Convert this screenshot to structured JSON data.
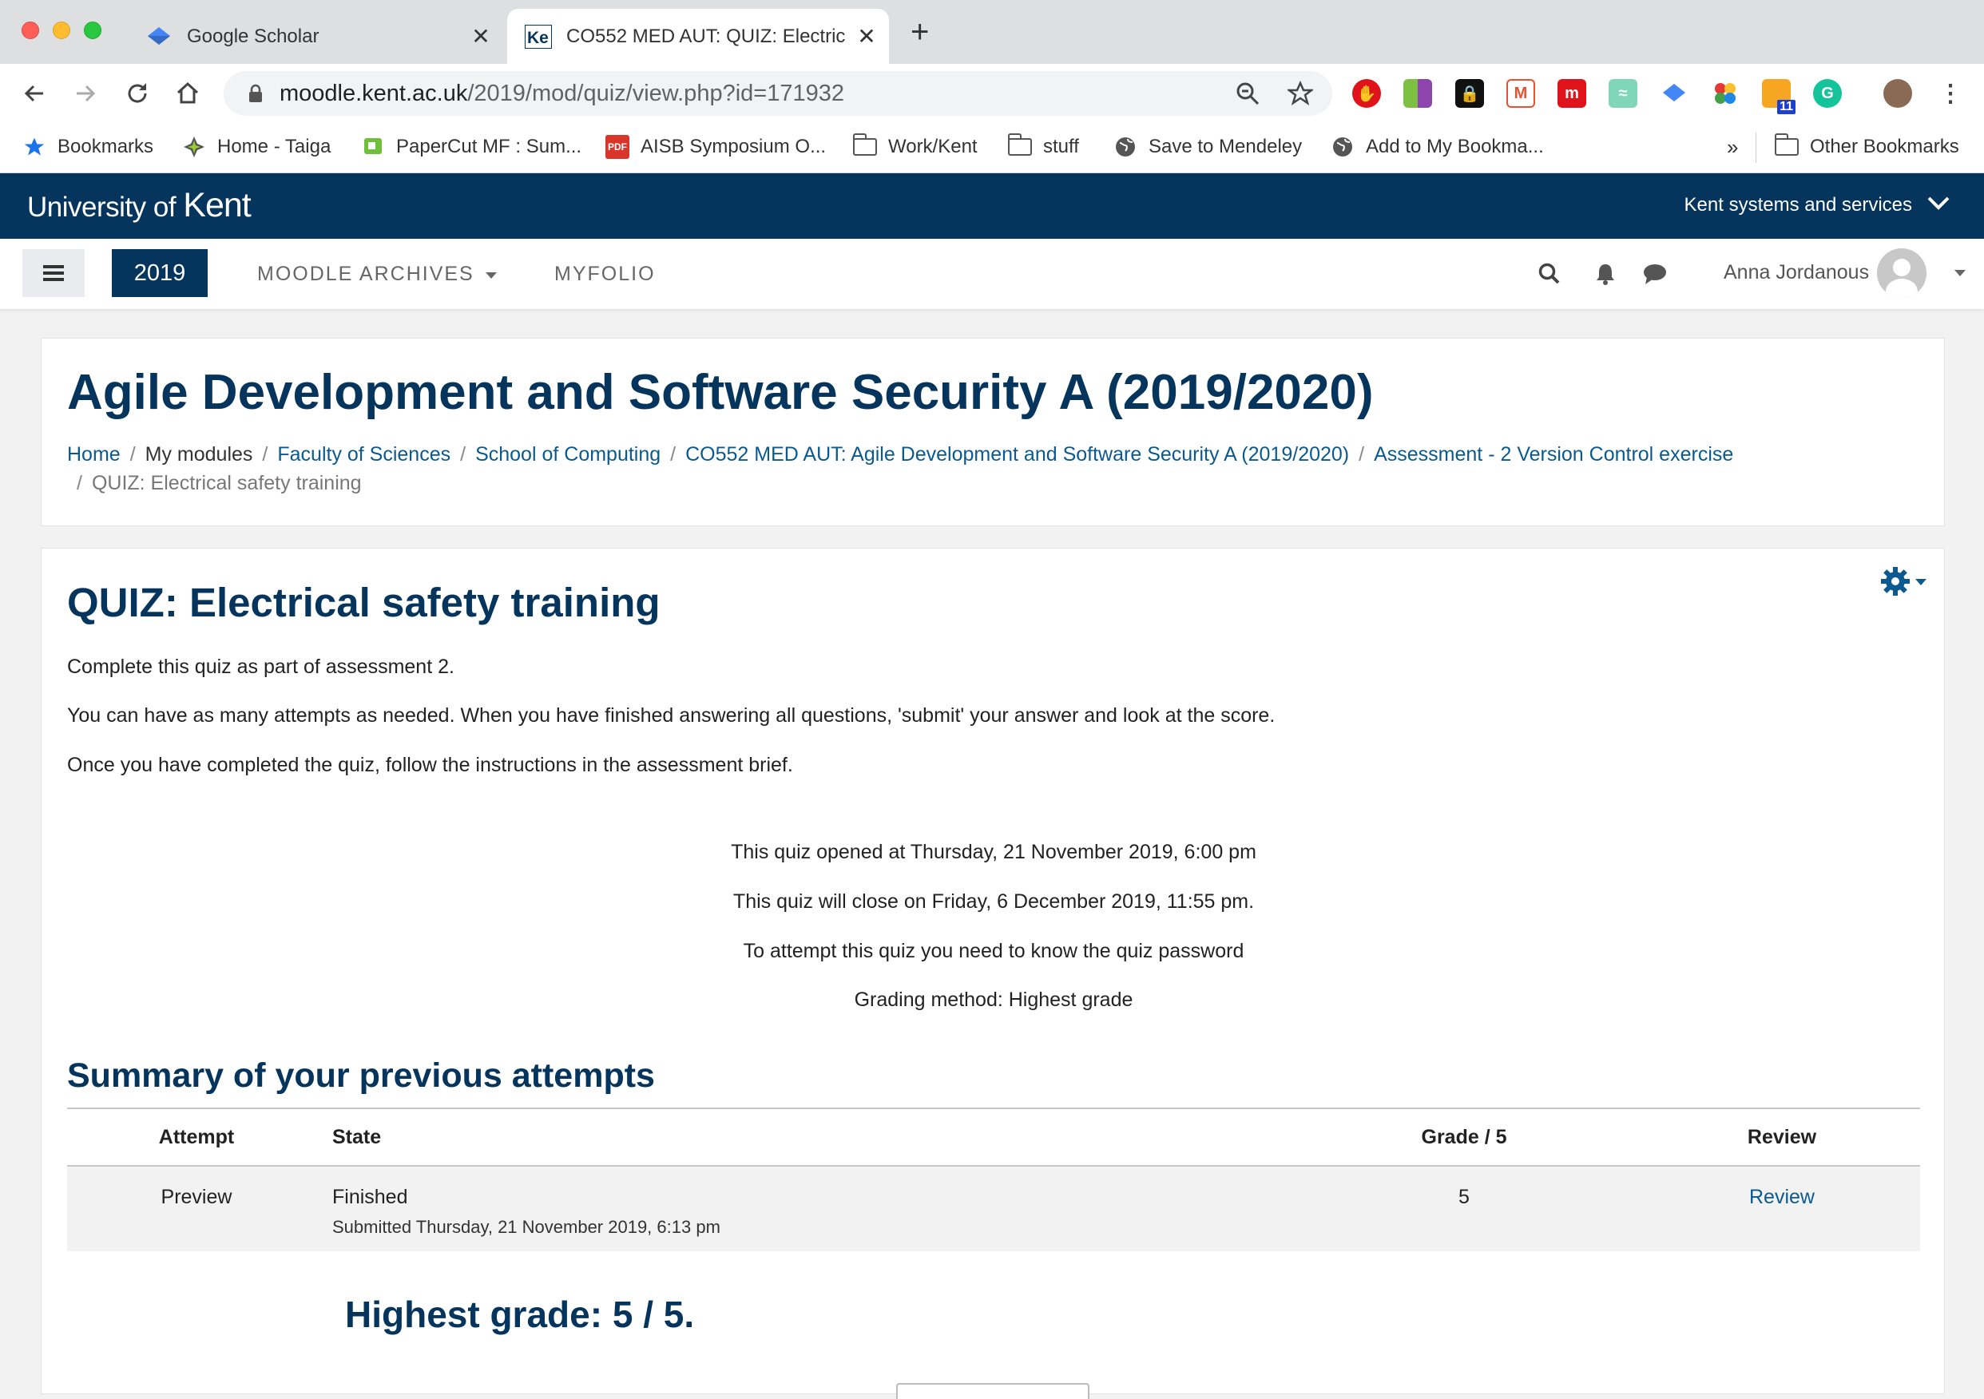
{
  "browser": {
    "tabs": [
      {
        "title": "Google Scholar",
        "active": false
      },
      {
        "title": "CO552 MED AUT: QUIZ: Electric",
        "active": true
      }
    ],
    "url_host": "moodle.kent.ac.uk",
    "url_path": "/2019/mod/quiz/view.php?id=171932",
    "bookmarks": [
      {
        "label": "Bookmarks",
        "icon": "star-icon"
      },
      {
        "label": "Home - Taiga",
        "icon": "taiga-icon"
      },
      {
        "label": "PaperCut MF : Sum...",
        "icon": "papercut-icon"
      },
      {
        "label": "AISB Symposium O...",
        "icon": "pdf-icon"
      },
      {
        "label": "Work/Kent",
        "icon": "folder-icon"
      },
      {
        "label": "stuff",
        "icon": "folder-icon"
      },
      {
        "label": "Save to Mendeley",
        "icon": "globe-icon"
      },
      {
        "label": "Add to My Bookma...",
        "icon": "globe-icon"
      }
    ],
    "bookmarks_overflow": "»",
    "other_bookmarks": "Other Bookmarks",
    "extension_badge": "11",
    "pdf_badge": "PDF"
  },
  "kent": {
    "logo_prefix": "University of",
    "logo_name": "Kent",
    "services": "Kent systems and services"
  },
  "moodle_nav": {
    "year": "2019",
    "archives": "MOODLE ARCHIVES",
    "myfolio": "MYFOLIO",
    "user": "Anna Jordanous"
  },
  "page_header": {
    "course_title": "Agile Development and Software Security A (2019/2020)",
    "breadcrumbs": [
      {
        "label": "Home",
        "link": true
      },
      {
        "label": "My modules",
        "link": false
      },
      {
        "label": "Faculty of Sciences",
        "link": true
      },
      {
        "label": "School of Computing",
        "link": true
      },
      {
        "label": "CO552 MED AUT: Agile Development and Software Security A (2019/2020)",
        "link": true
      },
      {
        "label": "Assessment - 2 Version Control exercise",
        "link": true
      },
      {
        "label": "QUIZ: Electrical safety training",
        "link": false
      }
    ]
  },
  "quiz": {
    "title": "QUIZ: Electrical safety training",
    "intro": [
      "Complete this quiz as part of assessment 2.",
      "You can have as many attempts as needed. When you have finished answering all questions, 'submit' your answer and look at the score.",
      "Once you have completed the quiz, follow the instructions in the assessment brief."
    ],
    "info": [
      "This quiz opened at Thursday, 21 November 2019, 6:00 pm",
      "This quiz will close on Friday, 6 December 2019, 11:55 pm.",
      "To attempt this quiz you need to know the quiz password",
      "Grading method: Highest grade"
    ],
    "summary_title": "Summary of your previous attempts",
    "table": {
      "headers": [
        "Attempt",
        "State",
        "Grade / 5",
        "Review"
      ],
      "rows": [
        {
          "attempt": "Preview",
          "state": "Finished",
          "submitted": "Submitted Thursday, 21 November 2019, 6:13 pm",
          "grade": "5",
          "review": "Review"
        }
      ]
    },
    "highest_grade": "Highest grade: 5 / 5."
  },
  "colors": {
    "kent_navy": "#05345c",
    "link_blue": "#0b5a8f"
  }
}
